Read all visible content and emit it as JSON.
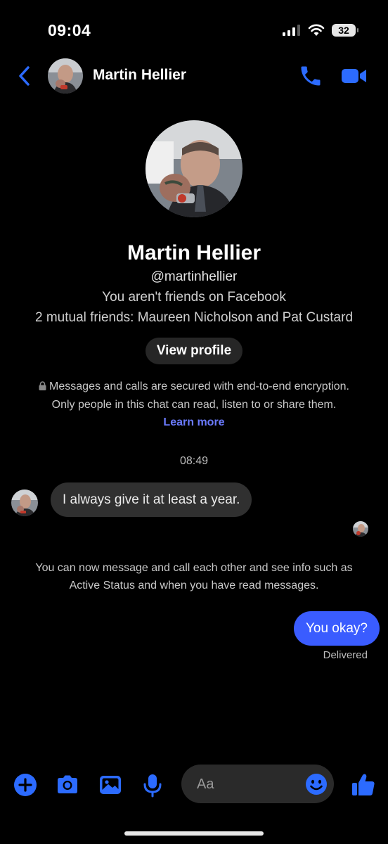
{
  "status_bar": {
    "time": "09:04",
    "battery": "32"
  },
  "header": {
    "name": "Martin Hellier",
    "icons": [
      "chevron-left-icon",
      "phone-icon",
      "video-camera-icon"
    ]
  },
  "profile": {
    "name": "Martin Hellier",
    "handle": "@martinhellier",
    "friend_status": "You aren't friends on Facebook",
    "mutual_friends": "2 mutual friends: Maureen Nicholson and Pat Custard",
    "view_profile_label": "View profile"
  },
  "encryption": {
    "line1": "Messages and calls are secured with end-to-end encryption.",
    "line2": "Only people in this chat can read, listen to or share them.",
    "learn_more": "Learn more"
  },
  "conversation": {
    "timestamp": "08:49",
    "incoming_message": "I always give it at least a year.",
    "notice_line1": "You can now message and call each other and see info such as",
    "notice_line2": "Active Status and when you have read messages.",
    "outgoing_message": "You okay?",
    "outgoing_status": "Delivered"
  },
  "composer": {
    "placeholder": "Aa",
    "tools": [
      "plus-icon",
      "camera-icon",
      "image-icon",
      "microphone-icon",
      "emoji-icon",
      "thumbs-up-icon"
    ]
  },
  "colors": {
    "accent": "#3a5cff",
    "icon_blue": "#2c6bff",
    "link": "#6b7bff",
    "bubble_in": "#303030"
  }
}
